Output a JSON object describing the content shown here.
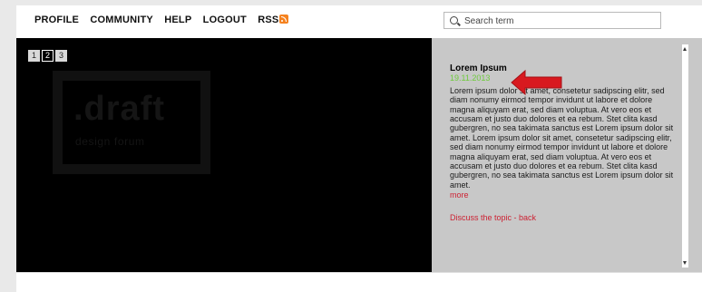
{
  "nav": {
    "items": [
      "PROFILE",
      "COMMUNITY",
      "HELP",
      "LOGOUT",
      "RSS"
    ],
    "rss_icon": "rss-icon"
  },
  "search": {
    "placeholder": "Search term",
    "value": ""
  },
  "slideshow": {
    "pages": [
      "1",
      "2",
      "3"
    ],
    "active_page": "2",
    "logo_word": ".draft",
    "logo_sub": "design forum"
  },
  "article": {
    "title": "Lorem Ipsum",
    "date": "19.11.2013",
    "body": "Lorem ipsum dolor sit amet, consetetur sadipscing elitr, sed diam nonumy eirmod tempor invidunt ut labore et dolore magna aliquyam erat, sed diam voluptua. At vero eos et accusam et justo duo dolores et ea rebum. Stet clita kasd gubergren, no sea takimata sanctus est Lorem ipsum dolor sit amet. Lorem ipsum dolor sit amet, consetetur sadipscing elitr, sed diam nonumy eirmod tempor invidunt ut labore et dolore magna aliquyam erat, sed diam voluptua. At vero eos et accusam et justo duo dolores et ea rebum. Stet clita kasd gubergren, no sea takimata sanctus est Lorem ipsum dolor sit amet.",
    "more_label": "more",
    "discuss_label": "Discuss the topic",
    "separator": " - ",
    "back_label": "back"
  },
  "colors": {
    "accent_red": "#cc2233",
    "date_green": "#6ecb3c",
    "arrow_red": "#d8191f"
  }
}
